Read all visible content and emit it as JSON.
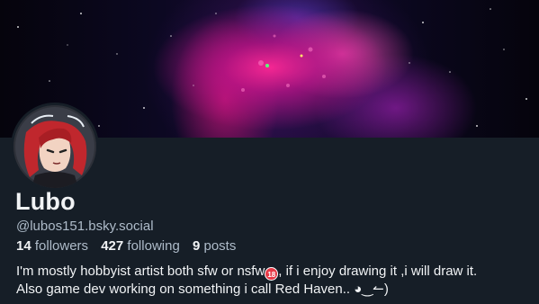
{
  "profile": {
    "display_name": "Lubo",
    "handle": "@lubos151.bsky.social",
    "stats": {
      "followers_count": "14",
      "followers_label": "followers",
      "following_count": "427",
      "following_label": "following",
      "posts_count": "9",
      "posts_label": "posts"
    },
    "bio": {
      "line1_before_emoji": "I'm mostly hobbyist artist both sfw or nsfw",
      "emoji_18": "18",
      "line1_after_emoji": ", if i enjoy drawing it ,i will draw it.",
      "line2": "Also game dev working on something i call Red Haven.. ◕‿↼)"
    }
  },
  "icons": {
    "avatar": "avatar-anime-girl-red-hair",
    "banner": "space-nebula-banner",
    "age_restriction": "no-under-18-emoji-icon"
  },
  "colors": {
    "background": "#161e27",
    "text_primary": "#f1f3f5",
    "text_secondary": "#aebbc9",
    "nebula_pink": "#ff2896"
  }
}
